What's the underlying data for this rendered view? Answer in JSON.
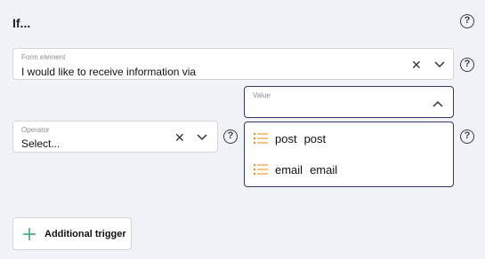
{
  "heading": "If...",
  "form_element": {
    "label": "Form element",
    "value": "I would like to receive information via"
  },
  "value_field": {
    "label": "Value",
    "options": [
      {
        "label": "post",
        "value": "post"
      },
      {
        "label": "email",
        "value": "email"
      }
    ]
  },
  "operator": {
    "label": "Operator",
    "value": "Select..."
  },
  "additional_trigger": {
    "label": "Additional trigger"
  },
  "icons": {
    "help": "?",
    "clear": "✕",
    "chevron_down": "chevron-down",
    "chevron_up": "chevron-up",
    "plus": "+"
  },
  "colors": {
    "accent_orange": "#f08a00",
    "accent_green": "#2fa36b",
    "active_border": "#2d3a6b"
  }
}
